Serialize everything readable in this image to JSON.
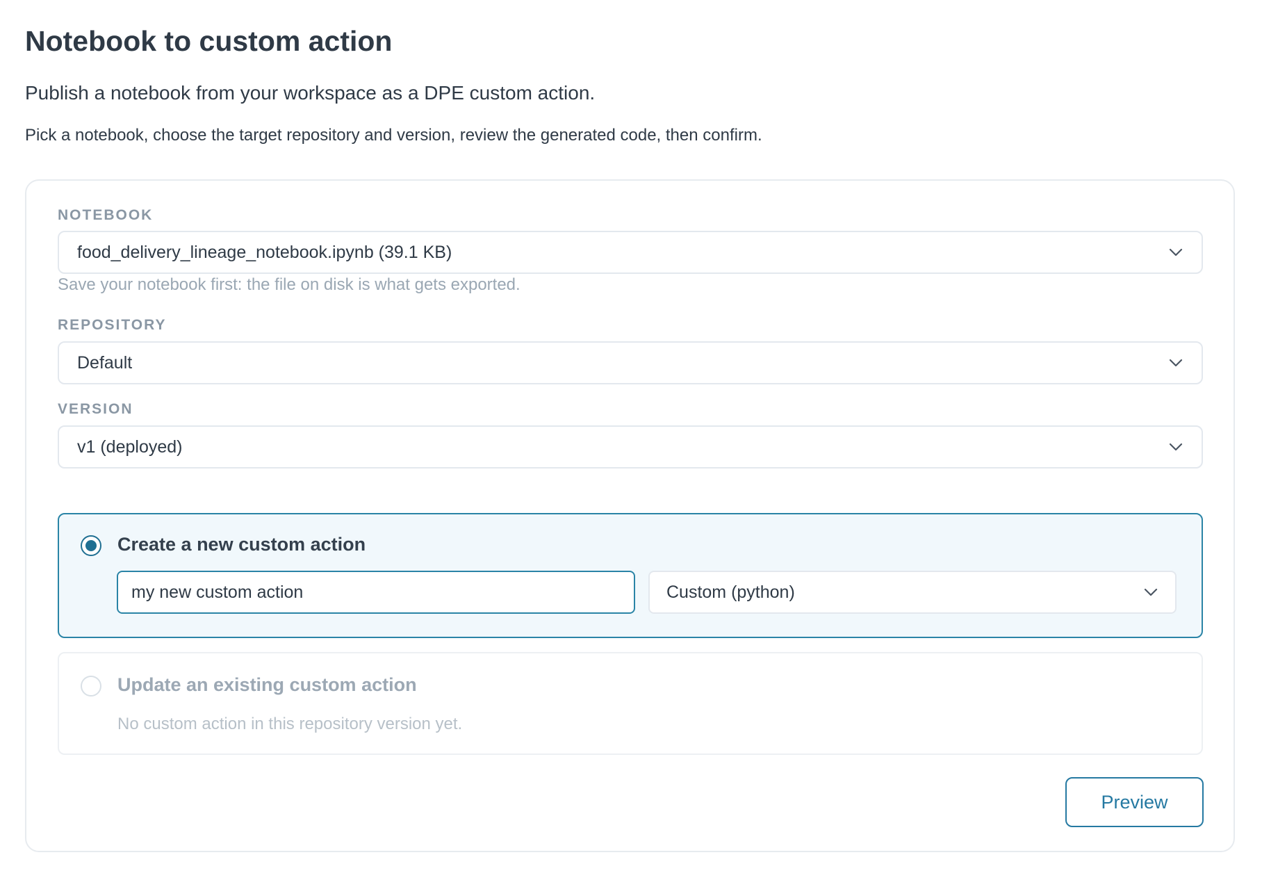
{
  "page": {
    "title": "Notebook to custom action",
    "subtitle": "Publish a notebook from your workspace as a DPE custom action.",
    "help_text": "Pick a notebook, choose the target repository and version, review the generated code, then confirm."
  },
  "form": {
    "notebook": {
      "label": "NOTEBOOK",
      "value": "food_delivery_lineage_notebook.ipynb (39.1 KB)",
      "hint": "Save your notebook first: the file on disk is what gets exported."
    },
    "repository": {
      "label": "REPOSITORY",
      "value": "Default"
    },
    "version": {
      "label": "VERSION",
      "value": "v1 (deployed)"
    },
    "action_mode": {
      "selected": "create",
      "create": {
        "label": "Create a new custom action",
        "name_value": "my new custom action",
        "type_value": "Custom (python)"
      },
      "update": {
        "label": "Update an existing custom action",
        "hint": "No custom action in this repository version yet."
      }
    },
    "preview_button": "Preview"
  },
  "icons": {
    "select_chevron": "chevron-down-icon",
    "radio_selected": "radio-selected-icon",
    "radio_unselected": "radio-unselected-icon"
  },
  "colors": {
    "accent": "#2579a2",
    "selected_panel_bg": "#f1f8fc",
    "muted_text": "#9aa7b3"
  }
}
